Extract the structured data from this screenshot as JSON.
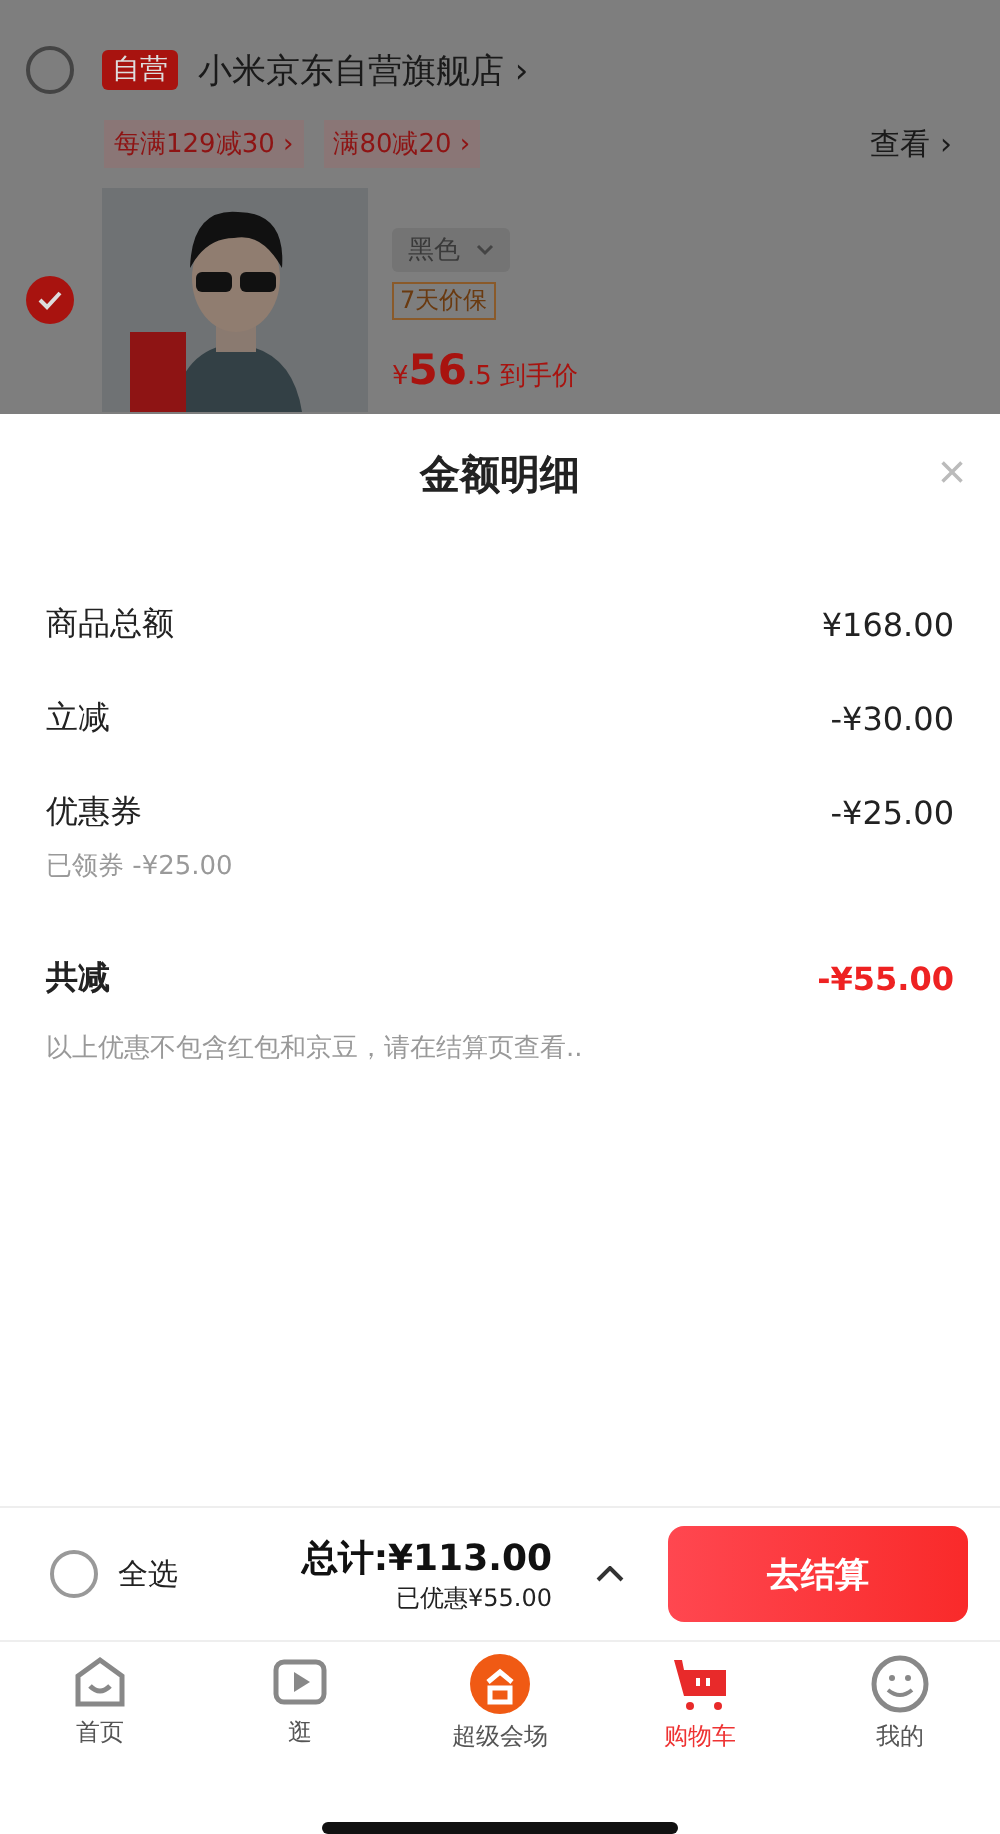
{
  "store": {
    "checked": false,
    "badge": "自营",
    "name": "小米京东自营旗舰店",
    "chevron": "›"
  },
  "promos": [
    {
      "text": "每满129减30 ›"
    },
    {
      "text": "满80减20 ›"
    }
  ],
  "view_link": "查看 ›",
  "product": {
    "checked": true,
    "variant": "黑色",
    "tag": "7天价保",
    "currency": "¥",
    "price_int": "56",
    "price_frac": ".5",
    "price_note": "到手价"
  },
  "modal": {
    "title": "金额明细",
    "close": "×",
    "rows": [
      {
        "label": "商品总额",
        "amount": "¥168.00"
      },
      {
        "label": "立减",
        "amount": "-¥30.00"
      },
      {
        "label": "优惠券",
        "amount": "-¥25.00",
        "note": "已领券 -¥25.00"
      }
    ],
    "total": {
      "label": "共减",
      "amount": "-¥55.00"
    },
    "disclaimer": "以上优惠不包含红包和京豆，请在结算页查看.."
  },
  "footer": {
    "select_all": {
      "label": "全选",
      "checked": false
    },
    "total": "总计:¥113.00",
    "saved": "已优惠¥55.00",
    "checkout": "去结算"
  },
  "tabs": [
    {
      "label": "首页",
      "kind": "home",
      "selected": false
    },
    {
      "label": "逛",
      "kind": "video",
      "selected": false
    },
    {
      "label": "超级会场",
      "kind": "promo",
      "selected": false
    },
    {
      "label": "购物车",
      "kind": "cart",
      "selected": true
    },
    {
      "label": "我的",
      "kind": "me",
      "selected": false
    }
  ]
}
